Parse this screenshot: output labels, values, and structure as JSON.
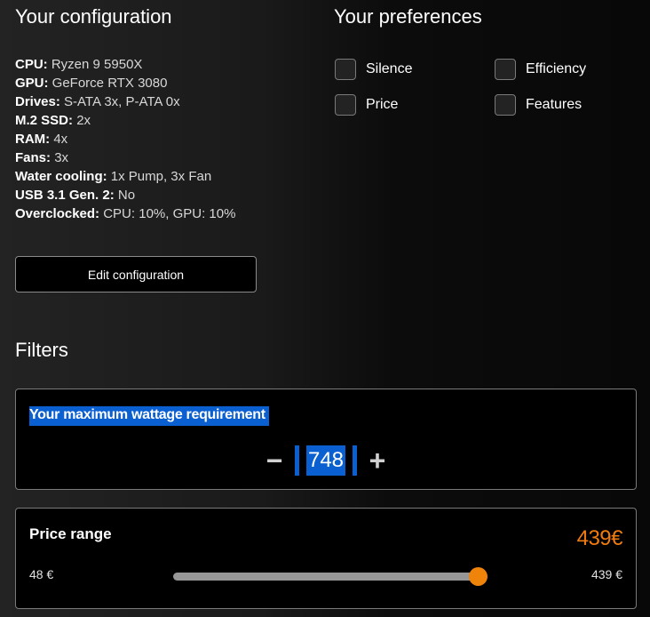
{
  "configuration": {
    "title": "Your configuration",
    "items": [
      {
        "label": "CPU:",
        "value": "Ryzen 9 5950X"
      },
      {
        "label": "GPU:",
        "value": "GeForce RTX 3080"
      },
      {
        "label": "Drives:",
        "value": "S-ATA 3x, P-ATA 0x"
      },
      {
        "label": "M.2 SSD:",
        "value": "2x"
      },
      {
        "label": "RAM:",
        "value": "4x"
      },
      {
        "label": "Fans:",
        "value": "3x"
      },
      {
        "label": "Water cooling:",
        "value": "1x Pump, 3x Fan"
      },
      {
        "label": "USB 3.1 Gen. 2:",
        "value": "No"
      },
      {
        "label": "Overclocked:",
        "value": "CPU: 10%, GPU: 10%"
      }
    ],
    "edit_button": "Edit configuration"
  },
  "preferences": {
    "title": "Your preferences",
    "options": [
      {
        "label": "Silence",
        "checked": false
      },
      {
        "label": "Efficiency",
        "checked": false
      },
      {
        "label": "Price",
        "checked": false
      },
      {
        "label": "Features",
        "checked": false
      }
    ]
  },
  "filters": {
    "title": "Filters",
    "wattage": {
      "label": "Your maximum wattage requirement",
      "value": "748",
      "decrement": "−",
      "increment": "+"
    },
    "price": {
      "label": "Price range",
      "current": "439€",
      "min_label": "48 €",
      "max_label": "439 €",
      "min": 48,
      "max": 439,
      "value": 439,
      "accent": "#f07b0e"
    }
  }
}
